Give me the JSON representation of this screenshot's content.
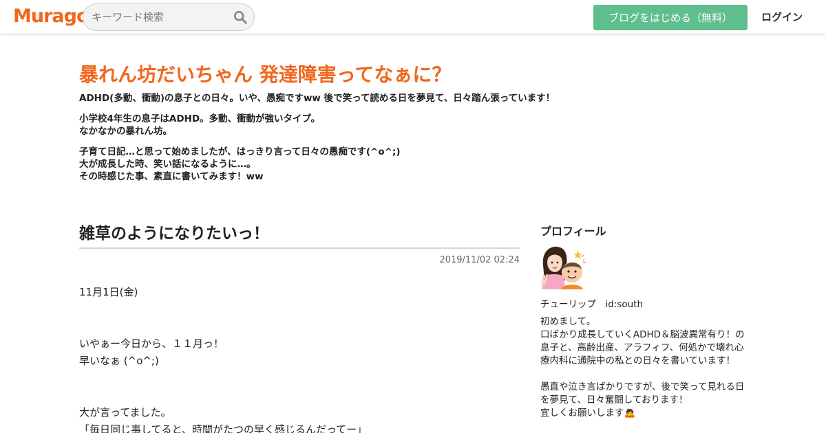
{
  "header": {
    "logo": "Muragon",
    "search_placeholder": "キーワード検索",
    "start_button": "ブログをはじめる（無料）",
    "login": "ログイン"
  },
  "blog": {
    "title": "暴れん坊だいちゃん 発達障害ってなぁに？",
    "description": [
      "ADHD(多動、衝動)の息子との日々。いや、愚痴ですww  後で笑って読める日を夢見て、日々踏ん張っています！",
      "小学校4年生の息子はADHD。多動、衝動が強いタイプ。\nなかなかの暴れん坊。",
      "子育て日記…と思って始めましたが、はっきり言って日々の愚痴です(^o^;)\n大が成長した時、笑い話になるように…。\nその時感じた事、素直に書いてみます！ww"
    ]
  },
  "post": {
    "title": "雑草のようになりたいっ！",
    "date": "2019/11/02 02:24",
    "paragraphs": [
      "11月1日(金)",
      "いやぁー今日から、１１月っ！\n早いなぁ (^o^;)",
      "大が言ってました。\n「毎日同じ事してると、時間がたつの早く感じるんだってー」"
    ]
  },
  "sidebar": {
    "heading": "プロフィール",
    "name": "チューリップ　id:south",
    "bio": "初めまして。\n口ばかり成長していくADHD＆脳波異常有り！の息子と、高齢出産、アラフィフ、何処かで壊れ心療内科に通院中の私との日々を書いています！\n\n愚直や泣き言ばかりですが、後で笑って見れる日を夢見て、日々奮闘しております！\n宜しくお願いします🙇"
  },
  "colors": {
    "brand_orange": "#f0671c",
    "button_green": "#5fbe8d"
  }
}
